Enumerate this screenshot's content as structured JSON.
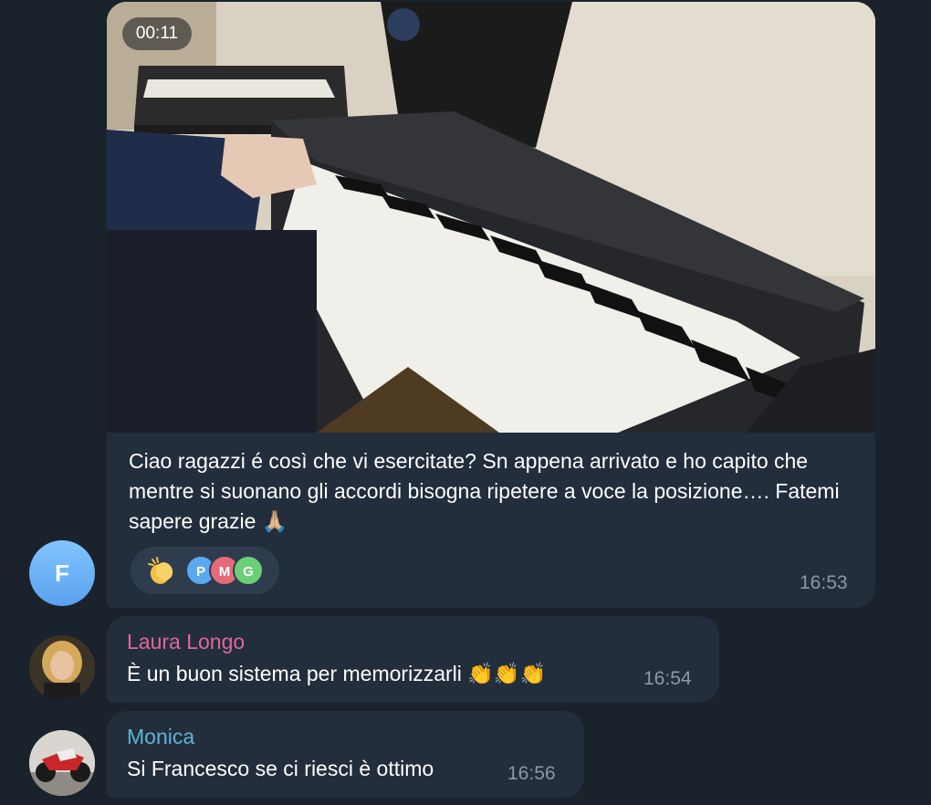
{
  "colors": {
    "background": "#1a222c",
    "bubble": "#222e3c",
    "timestamp": "#8d98a5",
    "sender_laura": "#e0679a",
    "sender_monica": "#5fb3d9"
  },
  "messages": [
    {
      "avatar_letter": "F",
      "video_duration": "00:11",
      "caption": "Ciao ragazzi é così che vi esercitate? Sn appena arrivato e ho capito che mentre si suonano gli accordi bisogna ripetere a voce la posizione…. Fatemi sapere grazie 🙏🏼",
      "reaction": {
        "emoji": "clapping-hands-icon",
        "avatars": [
          "P",
          "M",
          "G"
        ]
      },
      "time": "16:53"
    },
    {
      "sender": "Laura Longo",
      "text": "È un buon sistema per memorizzarli 👏👏👏",
      "time": "16:54"
    },
    {
      "sender": "Monica",
      "text": "Si Francesco se ci riesci è  ottimo",
      "time": "16:56"
    }
  ]
}
